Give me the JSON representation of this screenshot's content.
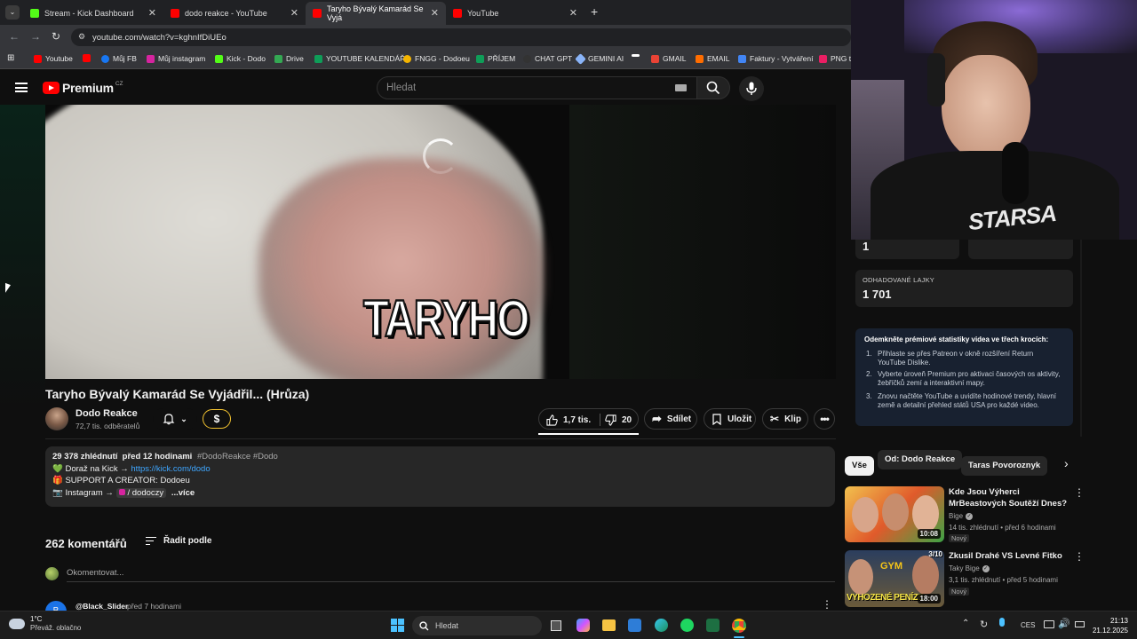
{
  "browser": {
    "tabs": [
      {
        "title": "Stream - Kick Dashboard",
        "color": "#53fc18"
      },
      {
        "title": "dodo reakce - YouTube",
        "color": "#ff0000"
      },
      {
        "title": "Taryho Bývalý Kamarád Se Vyjá",
        "color": "#ff0000"
      },
      {
        "title": "YouTube",
        "color": "#ff0000"
      }
    ],
    "new_tab": "+",
    "url": "youtube.com/watch?v=kghnIfDiUEo",
    "bookmarks": [
      {
        "label": "Youtube",
        "color": "#ff0000"
      },
      {
        "label": "",
        "color": "#ff0000"
      },
      {
        "label": "Můj FB",
        "color": "#1877f2"
      },
      {
        "label": "Můj instagram",
        "color": "#d6249f"
      },
      {
        "label": "Kick - Dodo",
        "color": "#53fc18"
      },
      {
        "label": "Drive",
        "color": "#34a853"
      },
      {
        "label": "YOUTUBE KALENDÁŘ",
        "color": "#0f9d58"
      },
      {
        "label": "FNGG - Dodoeu",
        "color": "#f4b400"
      },
      {
        "label": "PŘÍJEM",
        "color": "#0f9d58"
      },
      {
        "label": "CHAT GPT",
        "color": "#333333"
      },
      {
        "label": "GEMINI AI",
        "color": "#8ab4f8"
      },
      {
        "label": "",
        "color": "#ffffff"
      },
      {
        "label": "GMAIL",
        "color": "#ea4335"
      },
      {
        "label": "EMAIL",
        "color": "#ff6d00"
      },
      {
        "label": "Faktury - Vytváření",
        "color": "#4285f4"
      },
      {
        "label": "PNG t",
        "color": "#e91e63"
      }
    ]
  },
  "youtube": {
    "logo": "Premium",
    "logo_region": "CZ",
    "search_placeholder": "Hledat",
    "video_overlay_text": "TARYHO",
    "title": "Taryho Bývalý Kamarád Se Vyjádřil... (Hrůza)",
    "channel": {
      "name": "Dodo Reakce",
      "subs": "72,7 tis. odběratelů"
    },
    "likes": "1,7 tis.",
    "dislikes": "20",
    "share": "Sdílet",
    "save": "Uložit",
    "clip": "Klip",
    "description": {
      "stats": "29 378 zhlédnutí  před 12 hodinami",
      "tags": "#DodoReakce #Dodo",
      "line1_prefix": "💚 Doraž na Kick → ",
      "line1_link": "https://kick.com/dodo",
      "line2": "🎁 SUPPORT A CREATOR: Dodoeu",
      "line3_prefix": "📷 Instagram → ",
      "line3_handle": "/ dodoczy",
      "more": "...více"
    },
    "comments_count": "262 komentářů",
    "sort_label": "Řadit podle",
    "comment_placeholder": "Okomentovat...",
    "first_comment": {
      "author": "@Black_Slider",
      "time": "před 7 hodinami",
      "initial": "B"
    }
  },
  "stats_panel": {
    "top_value": "1",
    "likes_label": "ODHADOVANÉ LAJKY",
    "likes_value": "1 701",
    "premium_title": "Odemkněte prémiové statistiky videa ve třech krocích:",
    "steps": [
      "Přihlaste se přes Patreon v okně rozšíření Return YouTube Dislike.",
      "Vyberte úroveň Premium pro aktivaci časových os aktivity, žebříčků zemí a interaktivní mapy.",
      "Znovu načtěte YouTube a uvidíte hodinové trendy, hlavní země a detailní přehled států USA pro každé video."
    ]
  },
  "chips": [
    "Vše",
    "Od: Dodo Reakce",
    "Taras Povoroznyk"
  ],
  "recommended": [
    {
      "title": "Kde Jsou Výherci MrBeastových Soutěží Dnes?",
      "channel": "Bige",
      "meta": "14 tis. zhlédnutí • před 6 hodinami",
      "badge": "Nový",
      "duration": "10:08"
    },
    {
      "title": "Zkusil Drahé VS Levné Fitko",
      "channel": "Taky Bige",
      "meta": "3,1 tis. zhlédnutí • před 5 hodinami",
      "badge": "Nový",
      "duration": "18:00",
      "thumb_text": "VYHOZENÉ PENÍZE",
      "thumb_badge": "3/10",
      "thumb_sign": "GYM"
    }
  ],
  "webcam_text": "STARSA",
  "taskbar": {
    "weather_temp": "1°C",
    "weather_desc": "Převáž. oblačno",
    "search": "Hledat",
    "lang": "CES",
    "time": "21:13",
    "date": "21.12.2025"
  }
}
